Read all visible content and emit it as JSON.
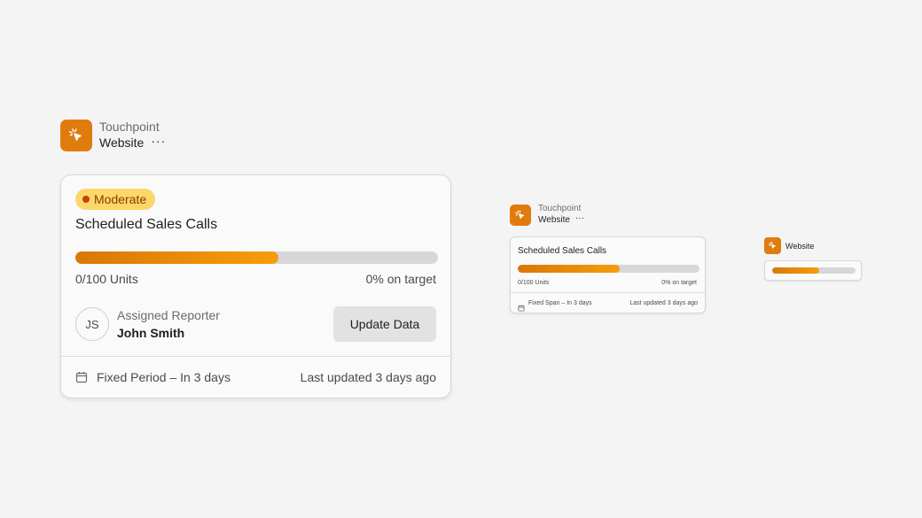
{
  "colors": {
    "accent": "#e07c0e",
    "badge_bg": "#fcd86a",
    "badge_text": "#8a3a00",
    "track": "#d7d7d9"
  },
  "large": {
    "header": {
      "category": "Touchpoint",
      "name": "Website",
      "more": "···",
      "icon": "cursor-click-icon"
    },
    "card": {
      "badge": "Moderate",
      "title": "Scheduled Sales Calls",
      "progress_fraction": 0.56,
      "units": "0/100 Units",
      "target": "0% on target",
      "reporter": {
        "initials": "JS",
        "label": "Assigned Reporter",
        "name": "John Smith"
      },
      "update_button": "Update Data",
      "period_icon": "calendar-icon",
      "period": "Fixed Period – In 3 days",
      "updated": "Last updated 3 days ago"
    }
  },
  "medium": {
    "header": {
      "category": "Touchpoint",
      "name": "Website",
      "more": "···",
      "icon": "cursor-click-icon"
    },
    "card": {
      "title": "Scheduled Sales Calls",
      "progress_fraction": 0.56,
      "units": "0/100 Units",
      "target": "0% on target",
      "period_icon": "calendar-icon",
      "period": "Fixed Span – In 3 days",
      "updated": "Last updated 3 days ago"
    }
  },
  "small": {
    "header": {
      "name": "Website",
      "icon": "cursor-click-icon"
    },
    "card": {
      "progress_fraction": 0.56
    }
  }
}
